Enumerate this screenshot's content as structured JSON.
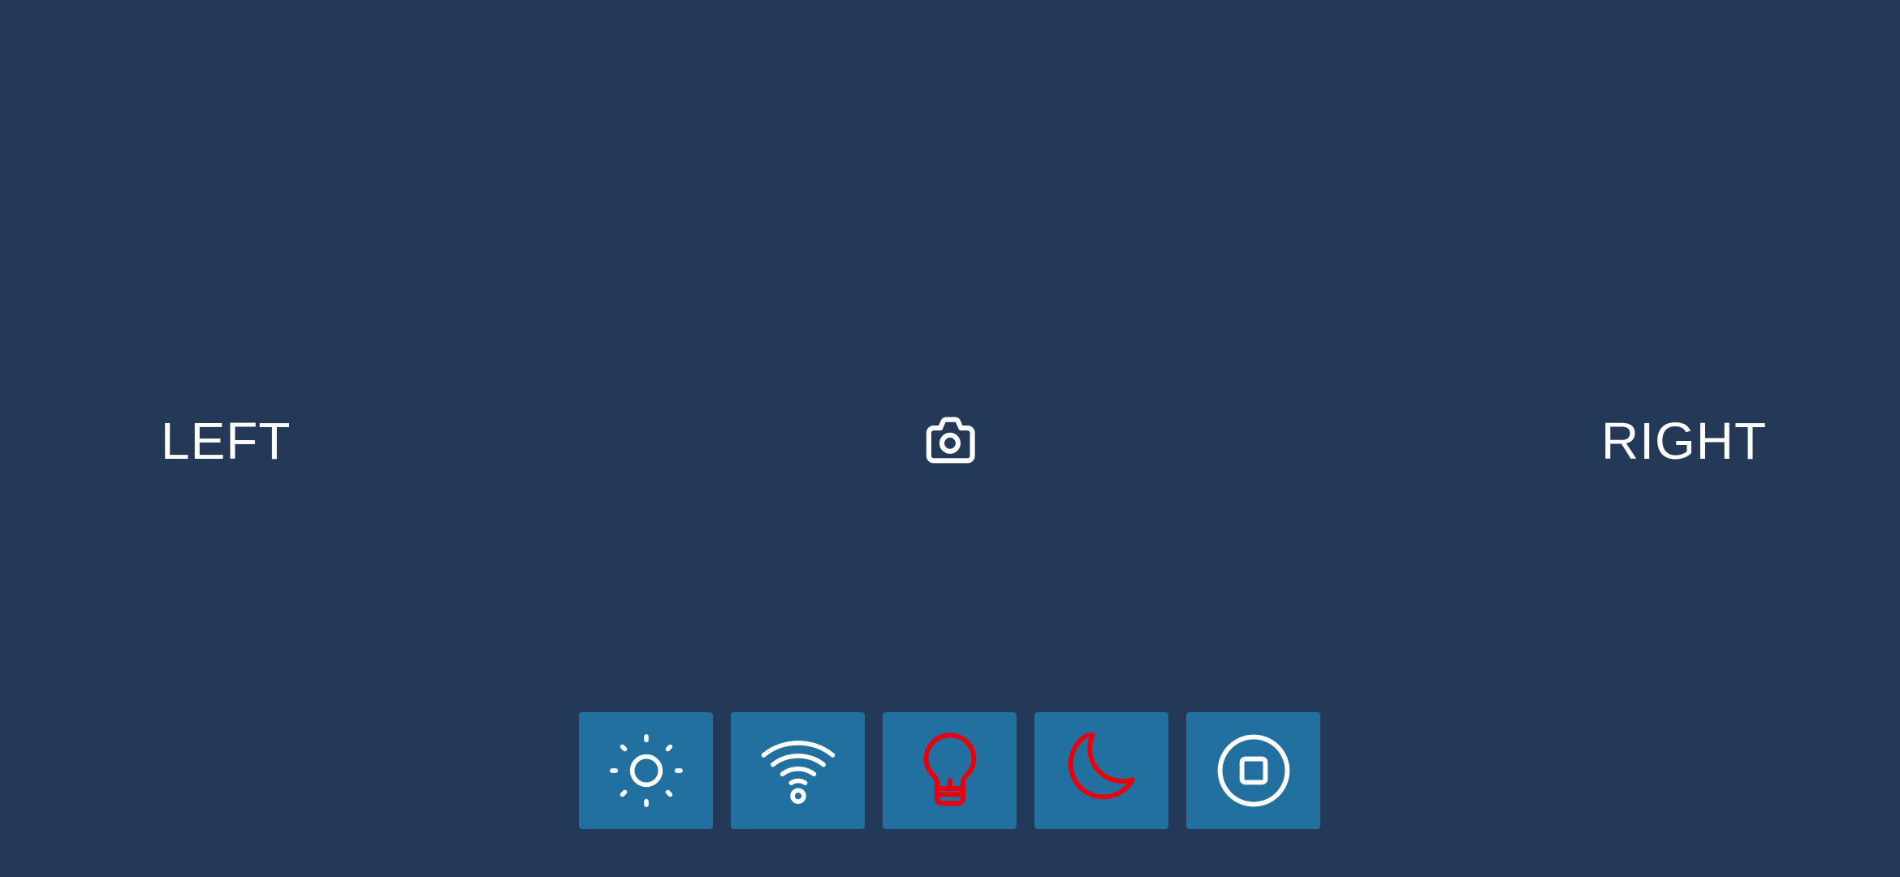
{
  "controls": {
    "left_label": "LEFT",
    "right_label": "RIGHT",
    "camera_icon": "camera-icon"
  },
  "toolbar": {
    "buttons": [
      {
        "icon": "brightness-icon",
        "color": "#ffffff"
      },
      {
        "icon": "wifi-icon",
        "color": "#ffffff"
      },
      {
        "icon": "lightbulb-icon",
        "color": "#e8000d"
      },
      {
        "icon": "moon-icon",
        "color": "#e8000d"
      },
      {
        "icon": "stop-circle-icon",
        "color": "#ffffff"
      }
    ]
  },
  "colors": {
    "background": "#243957",
    "button_bg": "#2170a0",
    "active_red": "#e8000d",
    "icon_white": "#ffffff"
  }
}
